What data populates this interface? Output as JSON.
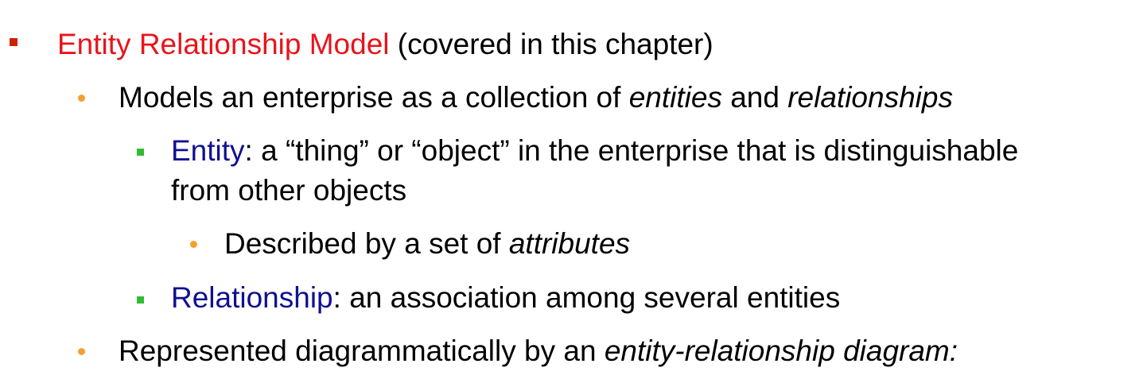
{
  "level1": {
    "term": "Entity Relationship Model",
    "rest": " (covered in this chapter)",
    "term_color": "#e8141b"
  },
  "item_models": {
    "prefix": "Models an enterprise as a collection of ",
    "em1": "entities",
    "mid": " and ",
    "em2": "relationships"
  },
  "item_entity": {
    "term": "Entity",
    "rest_line1": ": a “thing” or “object” in the enterprise that is distinguishable",
    "rest_line2": "from other objects",
    "term_color": "#101090"
  },
  "item_described": {
    "prefix": "Described by a set of ",
    "em": "attributes"
  },
  "item_relationship": {
    "term": "Relationship",
    "rest": ": an association among several entities",
    "term_color": "#101090"
  },
  "item_represented": {
    "prefix": "Represented diagrammatically by an ",
    "em": "entity-relationship diagram:"
  },
  "bullet_colors": {
    "level1": "#cc2200",
    "level2": "#f4a030",
    "level3": "#33bb33",
    "level4": "#f4a030"
  }
}
